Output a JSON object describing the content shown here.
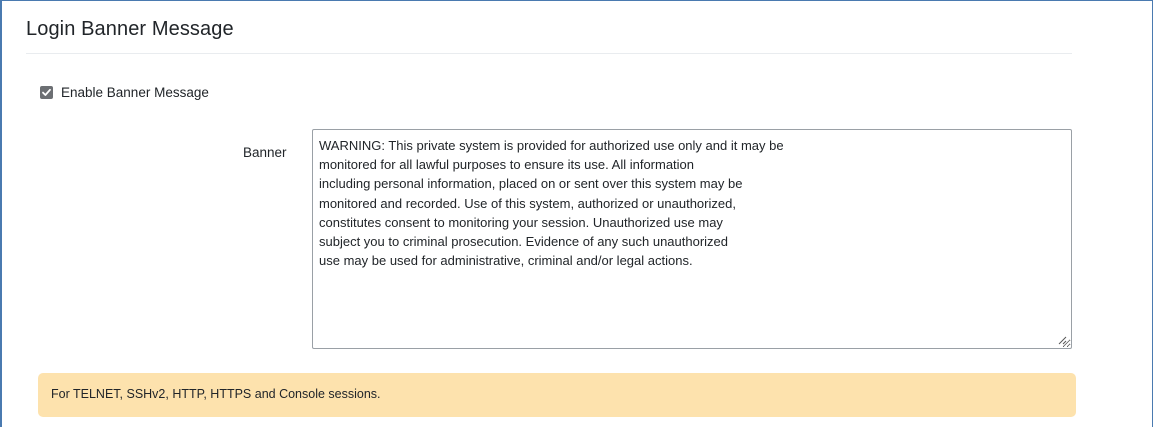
{
  "panel": {
    "title": "Login Banner Message"
  },
  "enable_banner": {
    "label": "Enable Banner Message",
    "checked": true
  },
  "banner": {
    "label": "Banner",
    "value": "WARNING: This private system is provided for authorized use only and it may be\nmonitored for all lawful purposes to ensure its use. All information\nincluding personal information, placed on or sent over this system may be\nmonitored and recorded. Use of this system, authorized or unauthorized,\nconstitutes consent to monitoring your session. Unauthorized use may\nsubject you to criminal prosecution. Evidence of any such unauthorized\nuse may be used for administrative, criminal and/or legal actions."
  },
  "notice": {
    "text": "For TELNET, SSHv2, HTTP, HTTPS and Console sessions."
  },
  "colors": {
    "frame_border": "#4a7ab0",
    "notice_background": "#fde2ad",
    "checkbox_fill": "#6c6f73"
  },
  "icons": {
    "checkbox": "checkmark-icon",
    "textarea_resize": "resize-grip-icon"
  }
}
